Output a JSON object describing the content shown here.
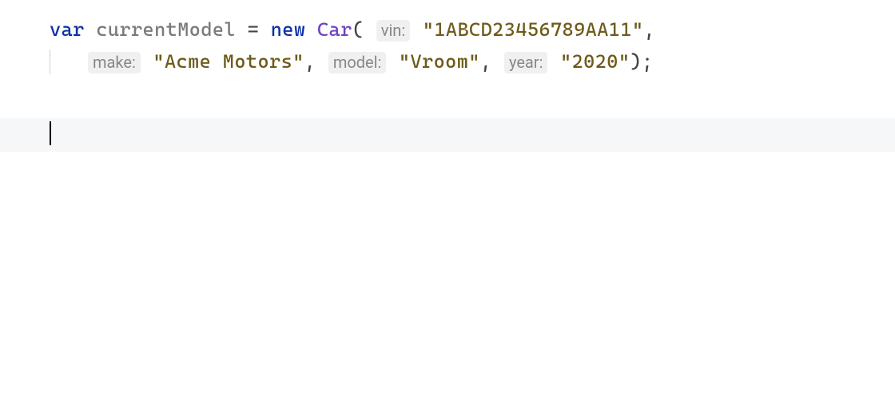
{
  "code": {
    "line1": {
      "kw_var": "var",
      "ident": "currentModel",
      "equals": "=",
      "kw_new": "new",
      "type": "Car",
      "open": "(",
      "hint_vin": "vin:",
      "str_vin": "\"1ABCD23456789AA11\"",
      "comma1": ","
    },
    "line2": {
      "hint_make": "make:",
      "str_make": "\"Acme Motors\"",
      "comma2": ",",
      "hint_model": "model:",
      "str_model": "\"Vroom\"",
      "comma3": ",",
      "hint_year": "year:",
      "str_year": "\"2020\"",
      "close": ")",
      "semi": ";"
    }
  }
}
